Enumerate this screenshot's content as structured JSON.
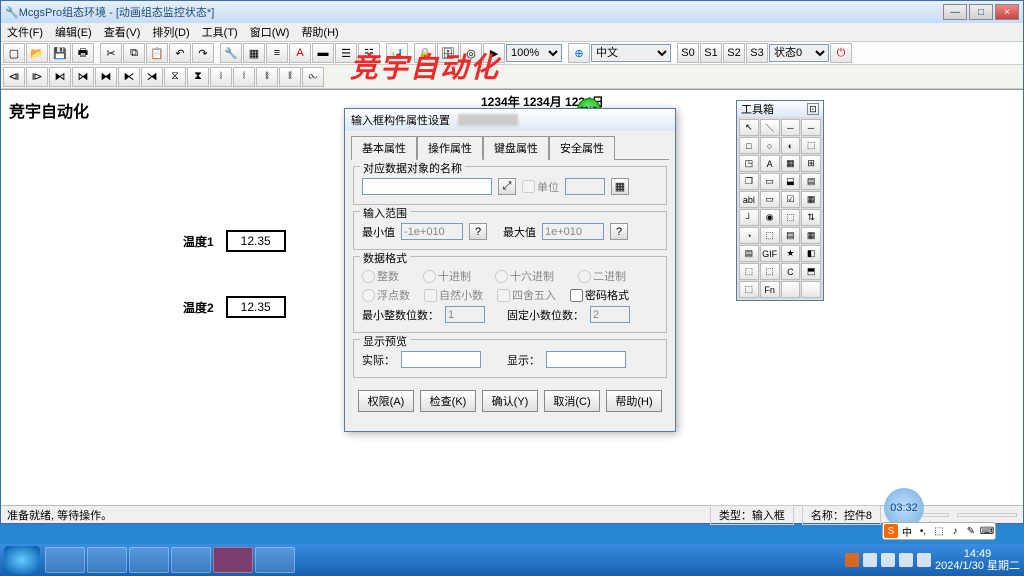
{
  "app": {
    "title": "McgsPro组态环境 - [动画组态监控状态*]"
  },
  "menu": [
    "文件(F)",
    "编辑(E)",
    "查看(V)",
    "排列(D)",
    "工具(T)",
    "窗口(W)",
    "帮助(H)"
  ],
  "toolbar": {
    "zoom": "100%",
    "lang": "中文",
    "stateBtns": [
      "S0",
      "S1",
      "S2",
      "S3"
    ],
    "stateSel": "状态0"
  },
  "overlay": "竞宇自动化",
  "canvas": {
    "heading": "竞宇自动化",
    "datetime": "1234年 1234月  1234日",
    "fields": [
      {
        "label": "温度1",
        "value": "12.35"
      },
      {
        "label": "温度2",
        "value": "12.35"
      }
    ]
  },
  "dialog": {
    "title": "输入框构件属性设置",
    "tabs": [
      "基本属性",
      "操作属性",
      "键盘属性",
      "安全属性"
    ],
    "active_tab": 1,
    "sec_object": {
      "legend": "对应数据对象的名称",
      "unit_chk": "单位"
    },
    "sec_range": {
      "legend": "输入范围",
      "min_lbl": "最小值",
      "min_val": "-1e+010",
      "max_lbl": "最大值",
      "max_val": "1e+010",
      "q": "?"
    },
    "sec_format": {
      "legend": "数据格式",
      "radios1": [
        "整数",
        "十进制",
        "十六进制",
        "二进制"
      ],
      "radios2": [
        "浮点数",
        "自然小数",
        "四舍五入",
        "密码格式"
      ],
      "min_int_lbl": "最小整数位数：",
      "min_int": "1",
      "fix_dec_lbl": "固定小数位数：",
      "fix_dec": "2"
    },
    "sec_preview": {
      "legend": "显示预览",
      "actual": "实际：",
      "display": "显示："
    },
    "buttons": [
      "权限(A)",
      "检查(K)",
      "确认(Y)",
      "取消(C)",
      "帮助(H)"
    ]
  },
  "palette": {
    "title": "工具箱",
    "items": [
      "↖",
      "＼",
      "─",
      "─",
      "□",
      "○",
      "◐",
      "⬚",
      "◳",
      "A",
      "▦",
      "⊞",
      "❒",
      "▭",
      "⬓",
      "▤",
      "abl",
      "▭",
      "☑",
      "▦",
      "┘",
      "◉",
      "⬚",
      "⇅",
      "◔",
      "⬚",
      "▤",
      "▦",
      "▤",
      "GIF",
      "★",
      "◧",
      "⬚",
      "⬚",
      "C",
      "⬒",
      "⬚",
      "Fn",
      "",
      ""
    ]
  },
  "status": {
    "msg": "准备就绪, 等待操作。",
    "type_lbl": "类型：",
    "type": "输入框",
    "name_lbl": "名称：",
    "name": "控件8"
  },
  "ime": {
    "chars": [
      "S",
      "中",
      "•,",
      "⬚",
      "♪",
      "✎",
      "⌨"
    ]
  },
  "bubble": "03:32",
  "taskbar": {
    "time": "14:49",
    "date": "2024/1/30 星期二"
  }
}
